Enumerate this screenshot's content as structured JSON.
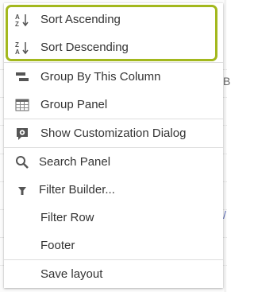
{
  "menu": {
    "items": [
      {
        "id": "sort_asc",
        "label": "Sort Ascending",
        "icon": "sort-ascending-icon"
      },
      {
        "id": "sort_desc",
        "label": "Sort Descending",
        "icon": "sort-descending-icon"
      },
      {
        "id": "group_by",
        "label": "Group By This Column",
        "icon": "group-by-column-icon"
      },
      {
        "id": "group_panel",
        "label": "Group Panel",
        "icon": "group-panel-icon"
      },
      {
        "id": "customization",
        "label": "Show Customization Dialog",
        "icon": "customization-icon"
      },
      {
        "id": "search_panel",
        "label": "Search Panel",
        "icon": "search-icon"
      },
      {
        "id": "filter_builder",
        "label": "Filter Builder...",
        "icon": "filter-icon"
      },
      {
        "id": "filter_row",
        "label": "Filter Row",
        "icon": ""
      },
      {
        "id": "footer",
        "label": "Footer",
        "icon": ""
      },
      {
        "id": "save_layout",
        "label": "Save layout",
        "icon": ""
      }
    ]
  },
  "highlight_color": "#a3b81d",
  "background": {
    "fragment_right": "B",
    "fragment_right2": "/"
  }
}
